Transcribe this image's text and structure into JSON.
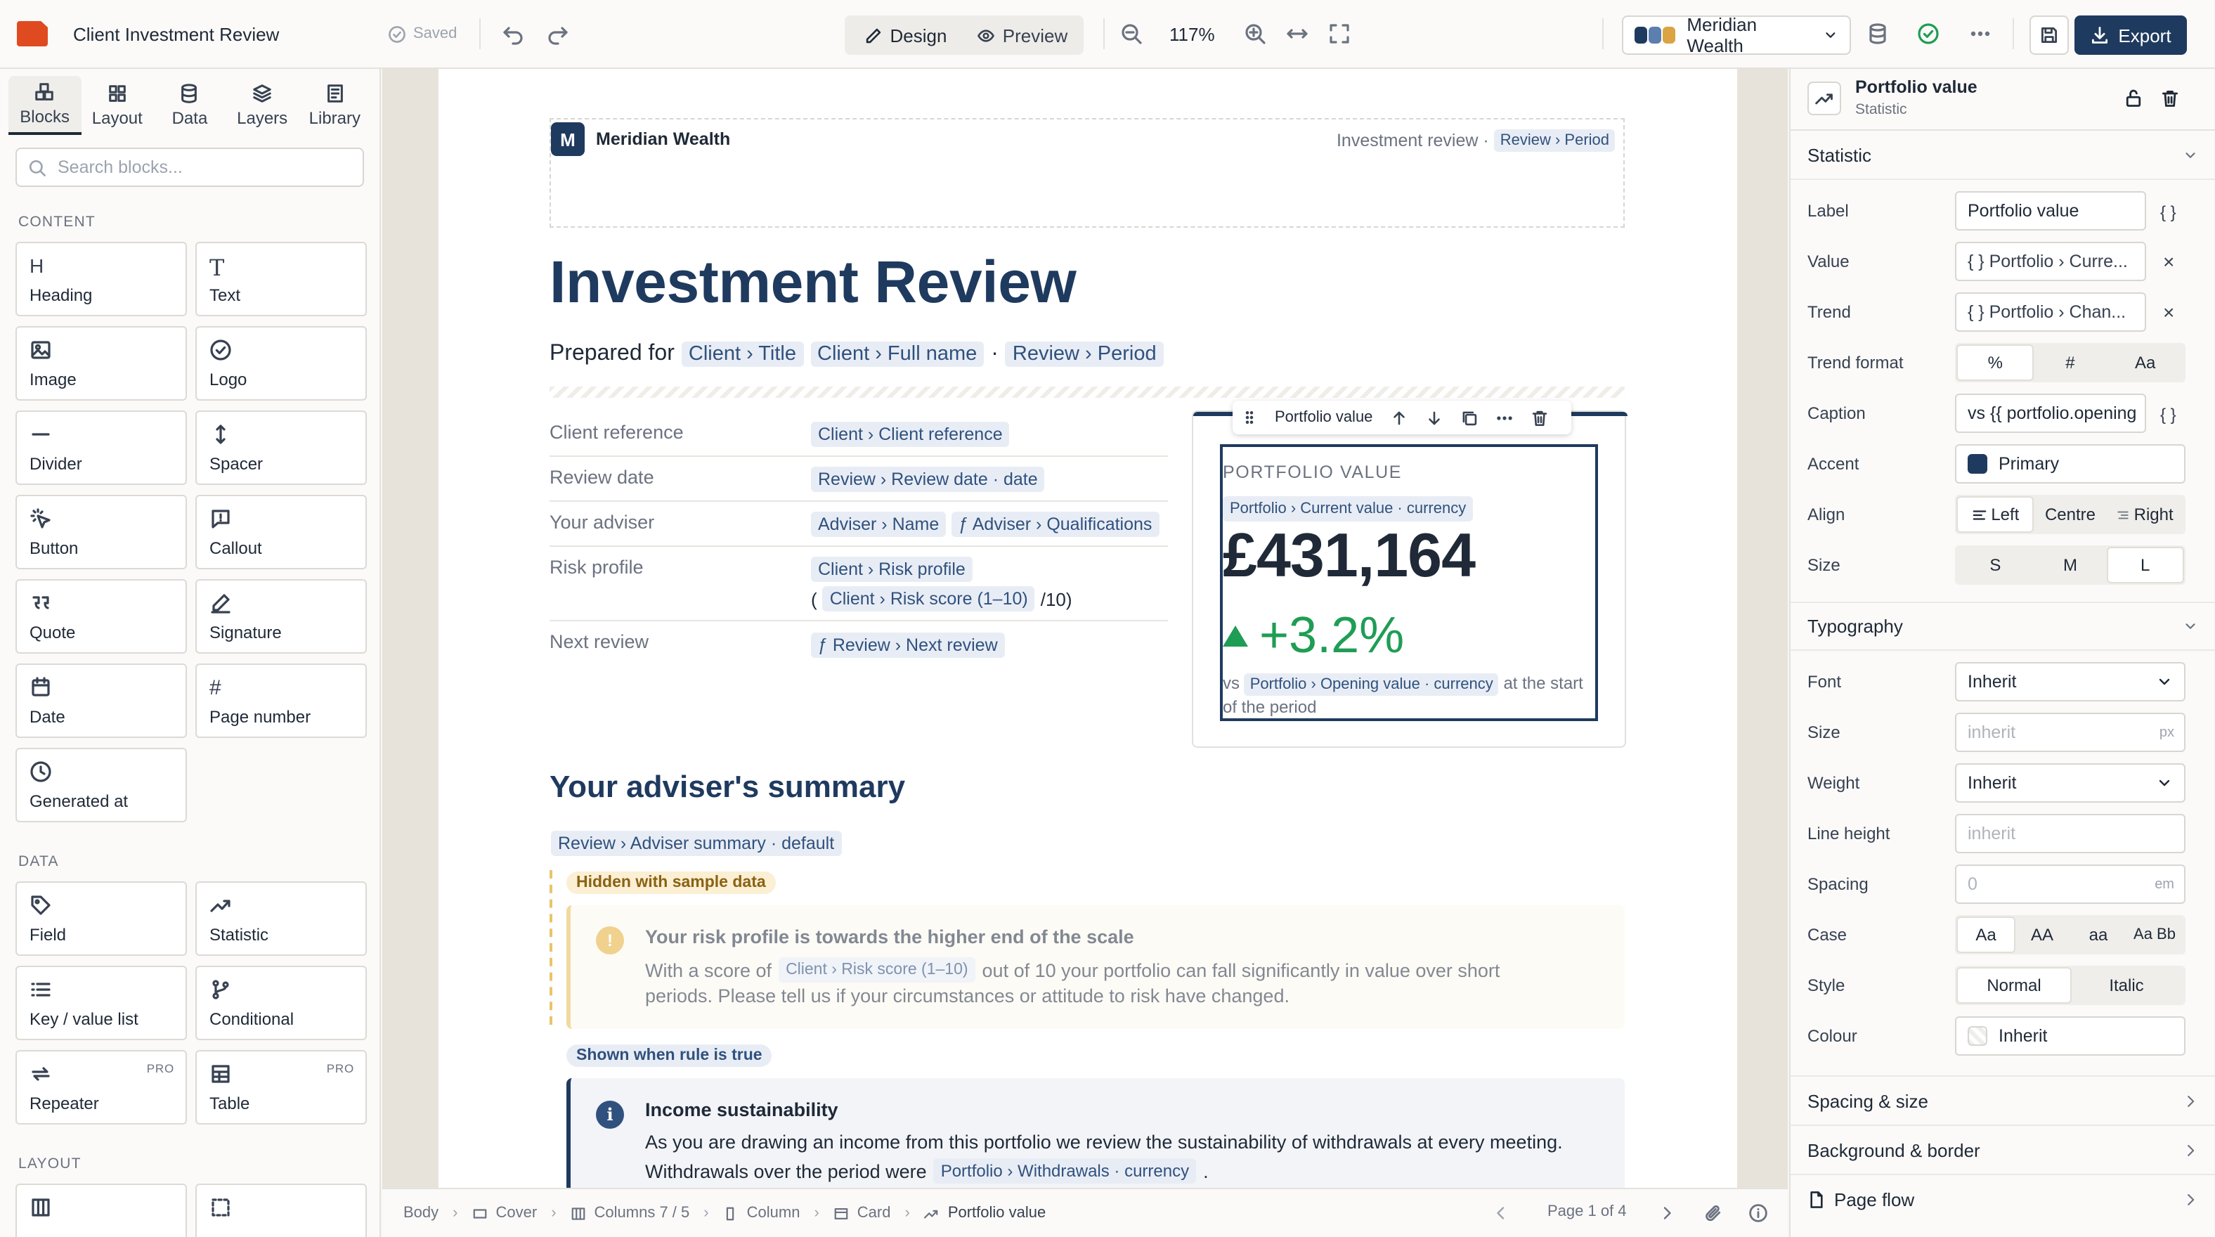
{
  "app": {
    "doc_title": "Client Investment Review",
    "saved": "Saved",
    "modes": [
      "Design",
      "Preview"
    ],
    "zoom": "117%",
    "brand": "Meridian Wealth",
    "export": "Export",
    "brand_colors": [
      "#1f3a5f",
      "#5b7fae",
      "#d9a441"
    ]
  },
  "left": {
    "tabs": [
      "Blocks",
      "Layout",
      "Data",
      "Layers",
      "Library"
    ],
    "search_placeholder": "Search blocks...",
    "content_label": "CONTENT",
    "content_blocks": [
      "Heading",
      "Text",
      "Image",
      "Logo",
      "Divider",
      "Spacer",
      "Button",
      "Callout",
      "Quote",
      "Signature",
      "Date",
      "Page number",
      "Generated at"
    ],
    "data_label": "DATA",
    "data_blocks": [
      "Field",
      "Statistic",
      "Key / value list",
      "Conditional",
      "Repeater",
      "Table"
    ],
    "pro": "PRO",
    "layout_label": "LAYOUT"
  },
  "doc": {
    "brand_initial": "M",
    "brand_name": "Meridian Wealth",
    "header_right": "Investment review ·",
    "header_chip": "Review › Period",
    "title": "Investment Review",
    "prepared": "Prepared for",
    "prep_chips": [
      "Client › Title",
      "Client › Full name",
      "Review › Period"
    ],
    "prep_dot": "·",
    "kv": [
      {
        "k": "Client reference",
        "v": [
          "Client › Client reference"
        ]
      },
      {
        "k": "Review date",
        "v": [
          "Review › Review date · date"
        ]
      },
      {
        "k": "Your adviser",
        "v": [
          "Adviser › Name",
          "ƒ Adviser › Qualifications"
        ]
      },
      {
        "k": "Risk profile",
        "v": [
          "Client › Risk profile"
        ],
        "v2_open": "(",
        "v2_chip": "Client › Risk score (1–10)",
        "v2_close": "/10)"
      },
      {
        "k": "Next review",
        "v": [
          "ƒ Review › Next review"
        ]
      }
    ],
    "stat": {
      "toolbar_label": "Portfolio value",
      "label": "PORTFOLIO VALUE",
      "value_chip": "Portfolio › Current value · currency",
      "value": "£431,164",
      "trend": "+3.2%",
      "cap_pre": "vs",
      "cap_chip": "Portfolio › Opening value · currency",
      "cap_post": "at the start of the period"
    },
    "summary_title": "Your adviser's summary",
    "summary_chip": "Review › Adviser summary · default",
    "hidden_tag": "Hidden with sample data",
    "risk_title": "Your risk profile is towards the higher end of the scale",
    "risk_pre": "With a score of",
    "risk_chip": "Client › Risk score (1–10)",
    "risk_post": "out of 10 your portfolio can fall significantly in value over short",
    "risk_line2": "periods. Please tell us if your circumstances or attitude to risk have changed.",
    "shown_tag": "Shown when rule is true",
    "income_title": "Income sustainability",
    "income_line1": "As you are drawing an income from this portfolio we review the sustainability of withdrawals at every meeting.",
    "income_pre": "Withdrawals over the period were",
    "income_chip": "Portfolio › Withdrawals · currency",
    "income_post": "."
  },
  "status": {
    "crumbs": [
      "Body",
      "Cover",
      "Columns 7 / 5",
      "Column",
      "Card",
      "Portfolio value"
    ],
    "page": "Page 1 of 4"
  },
  "right": {
    "title": "Portfolio value",
    "subtitle": "Statistic",
    "section_statistic": "Statistic",
    "label_label": "Label",
    "label_value": "Portfolio value",
    "value_label": "Value",
    "value_value": "{ }  Portfolio › Curre...",
    "trend_label": "Trend",
    "trend_value": "{ }  Portfolio › Chan...",
    "trend_format_label": "Trend format",
    "trend_formats": [
      "%",
      "#",
      "Aa"
    ],
    "caption_label": "Caption",
    "caption_value": "vs {{ portfolio.opening",
    "braces": "{ }",
    "accent_label": "Accent",
    "accent_value": "Primary",
    "accent_color": "#1f3a5f",
    "align_label": "Align",
    "align_options": [
      "Left",
      "Centre",
      "Right"
    ],
    "size_label": "Size",
    "size_options": [
      "S",
      "M",
      "L"
    ],
    "section_typography": "Typography",
    "font_label": "Font",
    "font_value": "Inherit",
    "tsize_label": "Size",
    "tsize_placeholder": "inherit",
    "px": "px",
    "weight_label": "Weight",
    "weight_value": "Inherit",
    "lh_label": "Line height",
    "lh_placeholder": "inherit",
    "spacing_label": "Spacing",
    "spacing_placeholder": "0",
    "em": "em",
    "case_label": "Case",
    "case_options": [
      "Aa",
      "AA",
      "aa",
      "Aa Bb"
    ],
    "style_label": "Style",
    "style_options": [
      "Normal",
      "Italic"
    ],
    "colour_label": "Colour",
    "colour_value": "Inherit",
    "section_spacing": "Spacing & size",
    "section_bg": "Background & border",
    "section_flow": "Page flow"
  }
}
